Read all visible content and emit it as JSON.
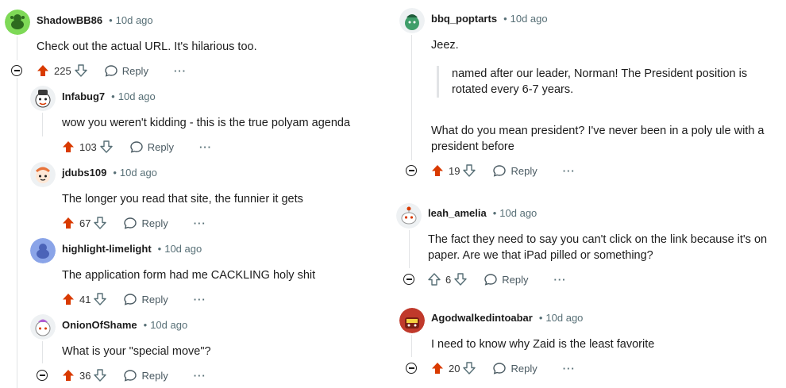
{
  "colors": {
    "upvote": "#d93a00",
    "text": "#1c1c1c",
    "meta": "#576f76",
    "thread": "#e2e4e6"
  },
  "left_comments": [
    {
      "user": "ShadowBB86",
      "dot": "•",
      "time": "10d ago",
      "body": "Check out the actual URL. It's hilarious too.",
      "score": "225",
      "reply": "Reply",
      "more": "···",
      "upvoted": true
    },
    {
      "user": "Infabug7",
      "dot": "•",
      "time": "10d ago",
      "body": "wow you weren't kidding - this is the true polyam agenda",
      "score": "103",
      "reply": "Reply",
      "more": "···",
      "upvoted": true
    },
    {
      "user": "jdubs109",
      "dot": "•",
      "time": "10d ago",
      "body": "The longer you read that site, the funnier it gets",
      "score": "67",
      "reply": "Reply",
      "more": "···",
      "upvoted": true
    },
    {
      "user": "highlight-limelight",
      "dot": "•",
      "time": "10d ago",
      "body": "The application form had me CACKLING holy shit",
      "score": "41",
      "reply": "Reply",
      "more": "···",
      "upvoted": true
    },
    {
      "user": "OnionOfShame",
      "dot": "•",
      "time": "10d ago",
      "body": "What is your \"special move\"?",
      "score": "36",
      "reply": "Reply",
      "more": "···",
      "upvoted": true
    }
  ],
  "right_comments": [
    {
      "user": "bbq_poptarts",
      "dot": "•",
      "time": "10d ago",
      "body": "Jeez.",
      "quote": "named after our leader, Norman! The President position is rotated every 6-7 years.",
      "body2": "What do you mean president? I've never been in a poly ule with a president before",
      "score": "19",
      "reply": "Reply",
      "more": "···",
      "upvoted": true
    },
    {
      "user": "leah_amelia",
      "dot": "•",
      "time": "10d ago",
      "body": "The fact they need to say you can't click on the link because it's on paper. Are we that iPad pilled or something?",
      "score": "6",
      "reply": "Reply",
      "more": "···",
      "upvoted": false
    },
    {
      "user": "Agodwalkedintoabar",
      "dot": "•",
      "time": "10d ago",
      "body": "I need to know why Zaid is the least favorite",
      "score": "20",
      "reply": "Reply",
      "more": "···",
      "upvoted": true
    }
  ]
}
